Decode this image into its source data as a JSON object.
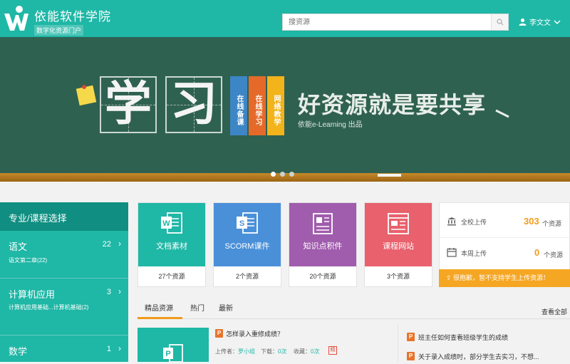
{
  "header": {
    "brand_name": "依能软件学院",
    "brand_sub": "数字化资源门户",
    "search_placeholder": "搜资源",
    "user_name": "李文文"
  },
  "banner": {
    "big_chars": [
      "学",
      "习"
    ],
    "tags": [
      "在线备课",
      "在线学习",
      "网络教学"
    ],
    "slogan": "好资源就是要共享",
    "credit": "依能e-Learning  出品",
    "slide_count": 3,
    "active_slide": 1
  },
  "sidebar": {
    "title": "专业/课程选择",
    "subjects": [
      {
        "name": "语文",
        "count": "22",
        "sub": "语文第二章(22)"
      },
      {
        "name": "计算机应用",
        "count": "3",
        "sub": "计算机应用基础...计算机基础(2)"
      },
      {
        "name": "数学",
        "count": "1",
        "sub": ""
      }
    ]
  },
  "categories": [
    {
      "label": "文档素材",
      "count": "27个资源",
      "color": "#1fb7a6",
      "icon": "word-doc-icon"
    },
    {
      "label": "SCORM课件",
      "count": "2个资源",
      "color": "#4a90d9",
      "icon": "scorm-icon"
    },
    {
      "label": "知识点积件",
      "count": "20个资源",
      "color": "#a05cad",
      "icon": "knowledge-icon"
    },
    {
      "label": "课程网站",
      "count": "3个资源",
      "color": "#e8616d",
      "icon": "website-icon"
    }
  ],
  "stats": {
    "school_label": "全校上传",
    "school_value": "303",
    "week_label": "本周上传",
    "week_value": "0",
    "unit": "个资源",
    "notice": "很抱歉，暂不支持学生上传资源！"
  },
  "tabs": {
    "items": [
      "精品资源",
      "热门",
      "最新"
    ],
    "active": 0,
    "view_all": "查看全部"
  },
  "resources": {
    "featured": {
      "title": "怎样录入重修成绩？",
      "uploader_label": "上传者：",
      "uploader": "罗小组",
      "downloads_label": "下载：",
      "downloads": "0次",
      "favorites_label": "收藏：",
      "favorites": "0次",
      "badge": "精"
    },
    "list": [
      "班主任如何查看班级学生的成绩",
      "关于录入成绩时，部分学生去实习，不想..."
    ]
  }
}
